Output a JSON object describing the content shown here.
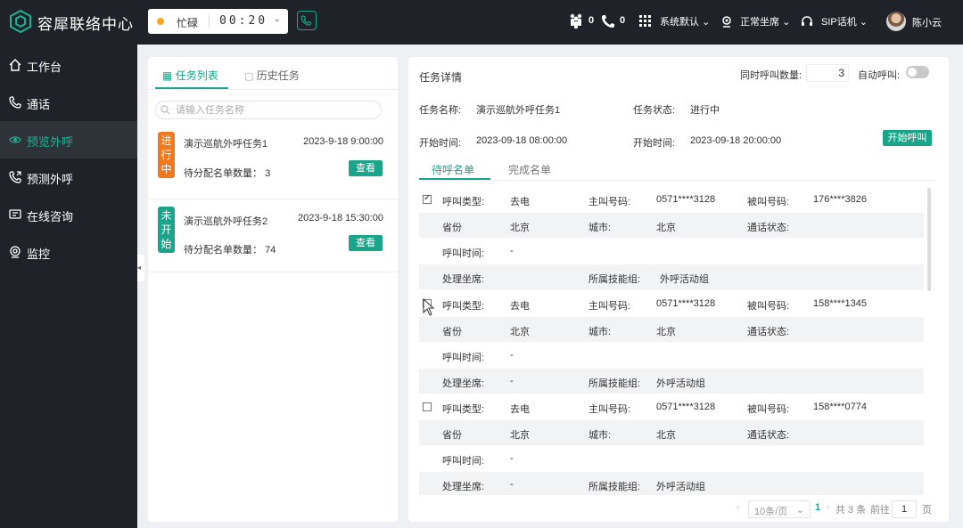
{
  "app": {
    "title": "容犀联络中心"
  },
  "status": {
    "state": "忙碌",
    "timer": "00:20",
    "dot_color": "#f5a623"
  },
  "topbar": {
    "agents_count": "0",
    "calls_count": "0",
    "system_label": "系统默认",
    "seat_status": "正常坐席",
    "sip_label": "SIP话机",
    "user_name": "陈小云"
  },
  "sidebar": {
    "items": [
      {
        "label": "工作台",
        "icon": "home-icon"
      },
      {
        "label": "通话",
        "icon": "phone-icon"
      },
      {
        "label": "预览外呼",
        "icon": "eye-icon"
      },
      {
        "label": "预测外呼",
        "icon": "phone-forward-icon"
      },
      {
        "label": "在线咨询",
        "icon": "chat-icon"
      },
      {
        "label": "监控",
        "icon": "monitor-icon"
      }
    ],
    "active_index": 2
  },
  "left_panel": {
    "tabs": [
      {
        "label": "任务列表"
      },
      {
        "label": "历史任务"
      }
    ],
    "search_placeholder": "请输入任务名称",
    "tasks": [
      {
        "badge": "进行中",
        "badge_color": "#f0781e",
        "name": "演示巡航外呼任务1",
        "time": "2023-9-18 9:00:00",
        "count_label": "待分配名单数量：",
        "count": "3",
        "button": "查看"
      },
      {
        "badge": "未开始",
        "badge_color": "#1aa58a",
        "name": "演示巡航外呼任务2",
        "time": "2023-9-18 15:30:00",
        "count_label": "待分配名单数量：",
        "count": "74",
        "button": "查看"
      }
    ]
  },
  "detail": {
    "title": "任务详情",
    "concurrent_label": "同时呼叫数量:",
    "concurrent_value": "3",
    "auto_call_label": "自动呼叫:",
    "auto_call_on": false,
    "task_name_label": "任务名称:",
    "task_name": "演示巡航外呼任务1",
    "task_status_label": "任务状态:",
    "task_status": "进行中",
    "start_time_label": "开始时间:",
    "start_time": "2023-09-18 08:00:00",
    "end_time_label": "开始时间:",
    "end_time": "2023-09-18 20:00:00",
    "start_call_button": "开始呼叫",
    "sub_tabs": [
      {
        "label": "待呼名单"
      },
      {
        "label": "完成名单"
      }
    ],
    "field_labels": {
      "call_type": "呼叫类型:",
      "caller": "主叫号码:",
      "callee": "被叫号码:",
      "province": "省份",
      "city": "城市:",
      "call_status": "通话状态:",
      "call_time": "呼叫时间:",
      "agent": "处理坐席:",
      "skill_group": "所属技能组:"
    },
    "records": [
      {
        "checked": true,
        "call_type": "去电",
        "caller": "0571****3128",
        "callee": "176****3826",
        "province": "北京",
        "city": "北京",
        "call_status": "",
        "call_time": "-",
        "agent": "",
        "skill_group": "外呼活动组"
      },
      {
        "checked": false,
        "call_type": "去电",
        "caller": "0571****3128",
        "callee": "158****1345",
        "province": "北京",
        "city": "北京",
        "call_status": "",
        "call_time": "-",
        "agent": "-",
        "skill_group": "外呼活动组"
      },
      {
        "checked": false,
        "call_type": "去电",
        "caller": "0571****3128",
        "callee": "158****0774",
        "province": "北京",
        "city": "北京",
        "call_status": "",
        "call_time": "-",
        "agent": "-",
        "skill_group": "外呼活动组"
      }
    ],
    "pagination": {
      "prev": "‹",
      "page_size": "10条/页",
      "current_page": "1",
      "next": "›",
      "total": "共 3 条",
      "goto_label": "前往",
      "goto_value": "1",
      "page_unit": "页"
    }
  },
  "colors": {
    "accent": "#1aa58a",
    "sidebar_bg": "#1f2329",
    "in_progress": "#f0781e"
  }
}
